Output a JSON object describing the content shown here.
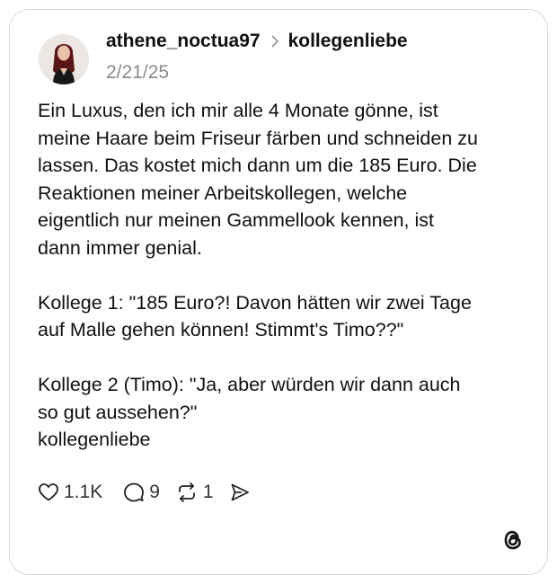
{
  "post": {
    "username": "athene_noctua97",
    "community": "kollegenliebe",
    "date": "2/21/25",
    "paragraphs": [
      "Ein Luxus, den ich mir alle 4 Monate gönne, ist\nmeine Haare beim Friseur färben und schneiden zu\nlassen. Das kostet mich dann um die 185 Euro. Die\nReaktionen meiner Arbeitskollegen, welche\neigentlich nur meinen Gammellook kennen, ist\ndann immer genial.",
      "Kollege 1: \"185 Euro?! Davon hätten wir zwei Tage\nauf Malle gehen können! Stimmt's Timo??\"",
      "Kollege 2 (Timo): \"Ja, aber würden wir dann auch\nso gut aussehen?\"\nkollegenliebe"
    ]
  },
  "actions": {
    "likes": "1.1K",
    "replies": "9",
    "reposts": "1"
  },
  "icons": {
    "like": "heart-icon",
    "reply": "speech-bubble-icon",
    "repost": "repost-arrows-icon",
    "share": "send-icon",
    "brand": "threads-logo-icon",
    "separator": "chevron-right-icon"
  }
}
